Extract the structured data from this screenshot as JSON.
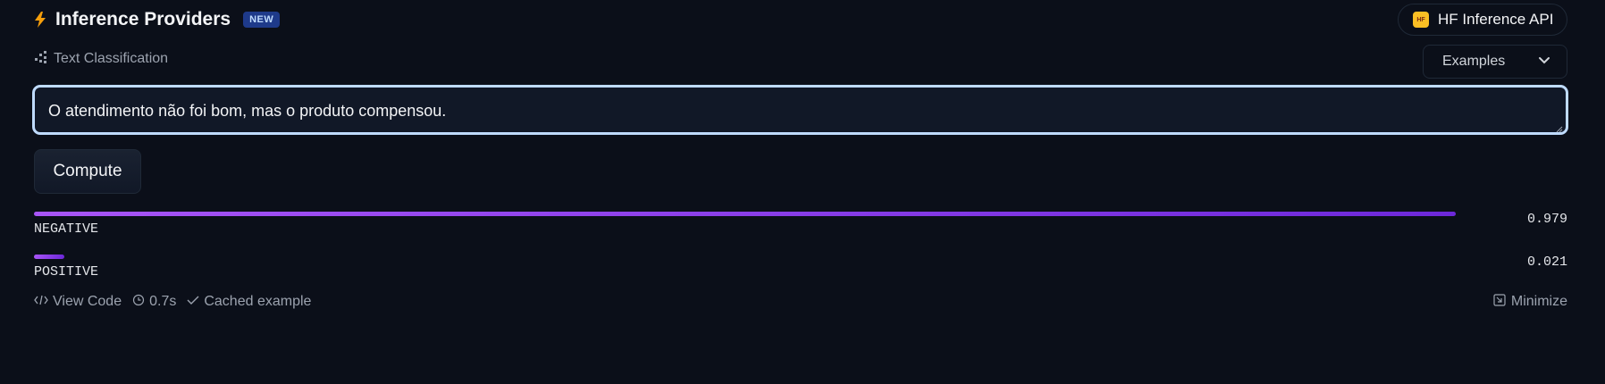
{
  "header": {
    "title": "Inference Providers",
    "badge": "NEW",
    "provider_label": "HF Inference API",
    "provider_logo_text": "HF"
  },
  "task": {
    "icon": "task-grid-icon",
    "label": "Text Classification"
  },
  "examples": {
    "label": "Examples"
  },
  "input": {
    "value": "O atendimento não foi bom, mas o produto compensou."
  },
  "compute": {
    "label": "Compute"
  },
  "results": [
    {
      "label": "NEGATIVE",
      "score": "0.979",
      "fraction": 0.979
    },
    {
      "label": "POSITIVE",
      "score": "0.021",
      "fraction": 0.021
    }
  ],
  "footer": {
    "view_code": "View Code",
    "time": "0.7s",
    "cached": "Cached example",
    "minimize": "Minimize"
  },
  "colors": {
    "background": "#0b0f19",
    "accent_bar": "#7c3aed",
    "input_border": "#bfdbfe",
    "badge_bg": "#1e3a8a"
  }
}
